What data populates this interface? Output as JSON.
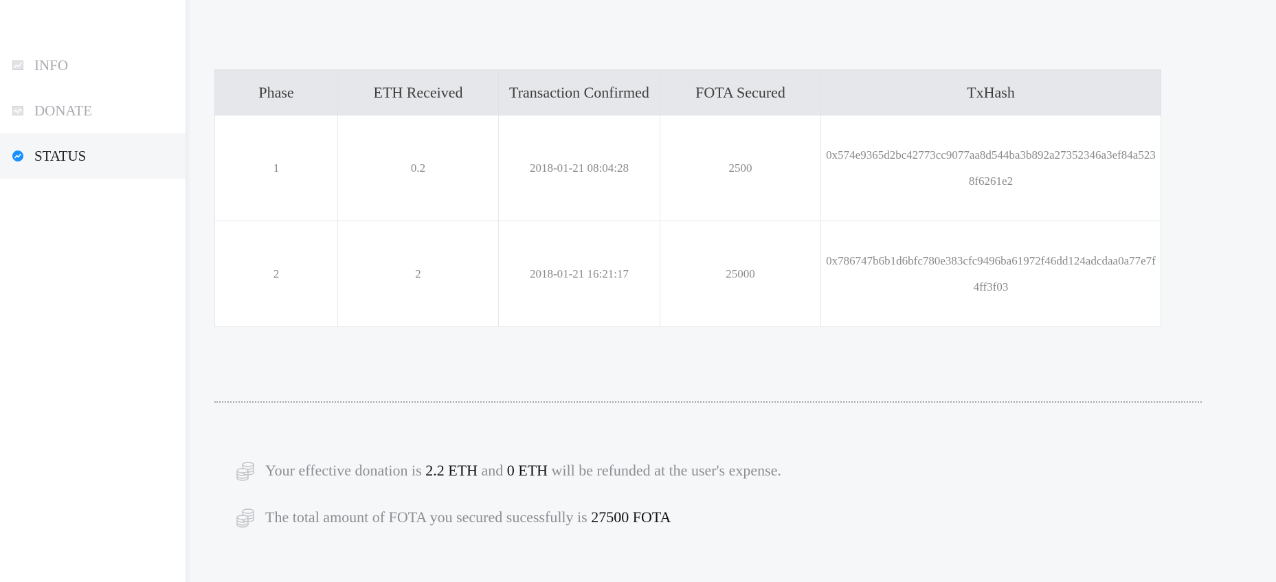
{
  "sidebar": {
    "items": [
      {
        "label": "INFO",
        "icon": "chart-icon",
        "active": false
      },
      {
        "label": "DONATE",
        "icon": "chart-line-icon",
        "active": false
      },
      {
        "label": "STATUS",
        "icon": "trending-icon",
        "active": true
      }
    ]
  },
  "table": {
    "headers": [
      "Phase",
      "ETH Received",
      "Transaction Confirmed",
      "FOTA Secured",
      "TxHash"
    ],
    "rows": [
      {
        "phase": "1",
        "eth": "0.2",
        "confirmed": "2018-01-21 08:04:28",
        "fota": "2500",
        "txhash": "0x574e9365d2bc42773cc9077aa8d544ba3b892a27352346a3ef84a5238f6261e2"
      },
      {
        "phase": "2",
        "eth": "2",
        "confirmed": "2018-01-21 16:21:17",
        "fota": "25000",
        "txhash": "0x786747b6b1d6bfc780e383cfc9496ba61972f46dd124adcdaa0a77e7f4ff3f03"
      }
    ]
  },
  "summary": {
    "line1": {
      "prefix": "Your effective donation is ",
      "effective": "2.2 ETH",
      "middle": " and ",
      "refund": "0 ETH",
      "suffix": " will be refunded at the user's expense."
    },
    "line2": {
      "prefix": "The total amount of FOTA you secured sucessfully is ",
      "total": "27500 FOTA"
    }
  },
  "colors": {
    "accent": "#1890ff",
    "sidebar_bg": "#ffffff",
    "page_bg": "#f6f7f9",
    "header_bg": "#e6e7ea"
  }
}
